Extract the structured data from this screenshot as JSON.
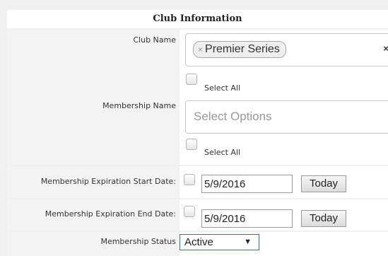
{
  "header": {
    "title": "Club Information"
  },
  "club_name": {
    "label": "Club Name",
    "selected_chip": "Premier Series",
    "chip_remove": "×",
    "clear_all": "×",
    "select_all_label": "Select All"
  },
  "membership_name": {
    "label": "Membership Name",
    "placeholder": "Select Options",
    "select_all_label": "Select All"
  },
  "expiration_start": {
    "label": "Membership Expiration Start Date:",
    "value": "5/9/2016",
    "today_label": "Today"
  },
  "expiration_end": {
    "label": "Membership Expiration End Date:",
    "value": "5/9/2016",
    "today_label": "Today"
  },
  "membership_status": {
    "label": "Membership Status",
    "selected": "Active",
    "caret": "▼"
  }
}
